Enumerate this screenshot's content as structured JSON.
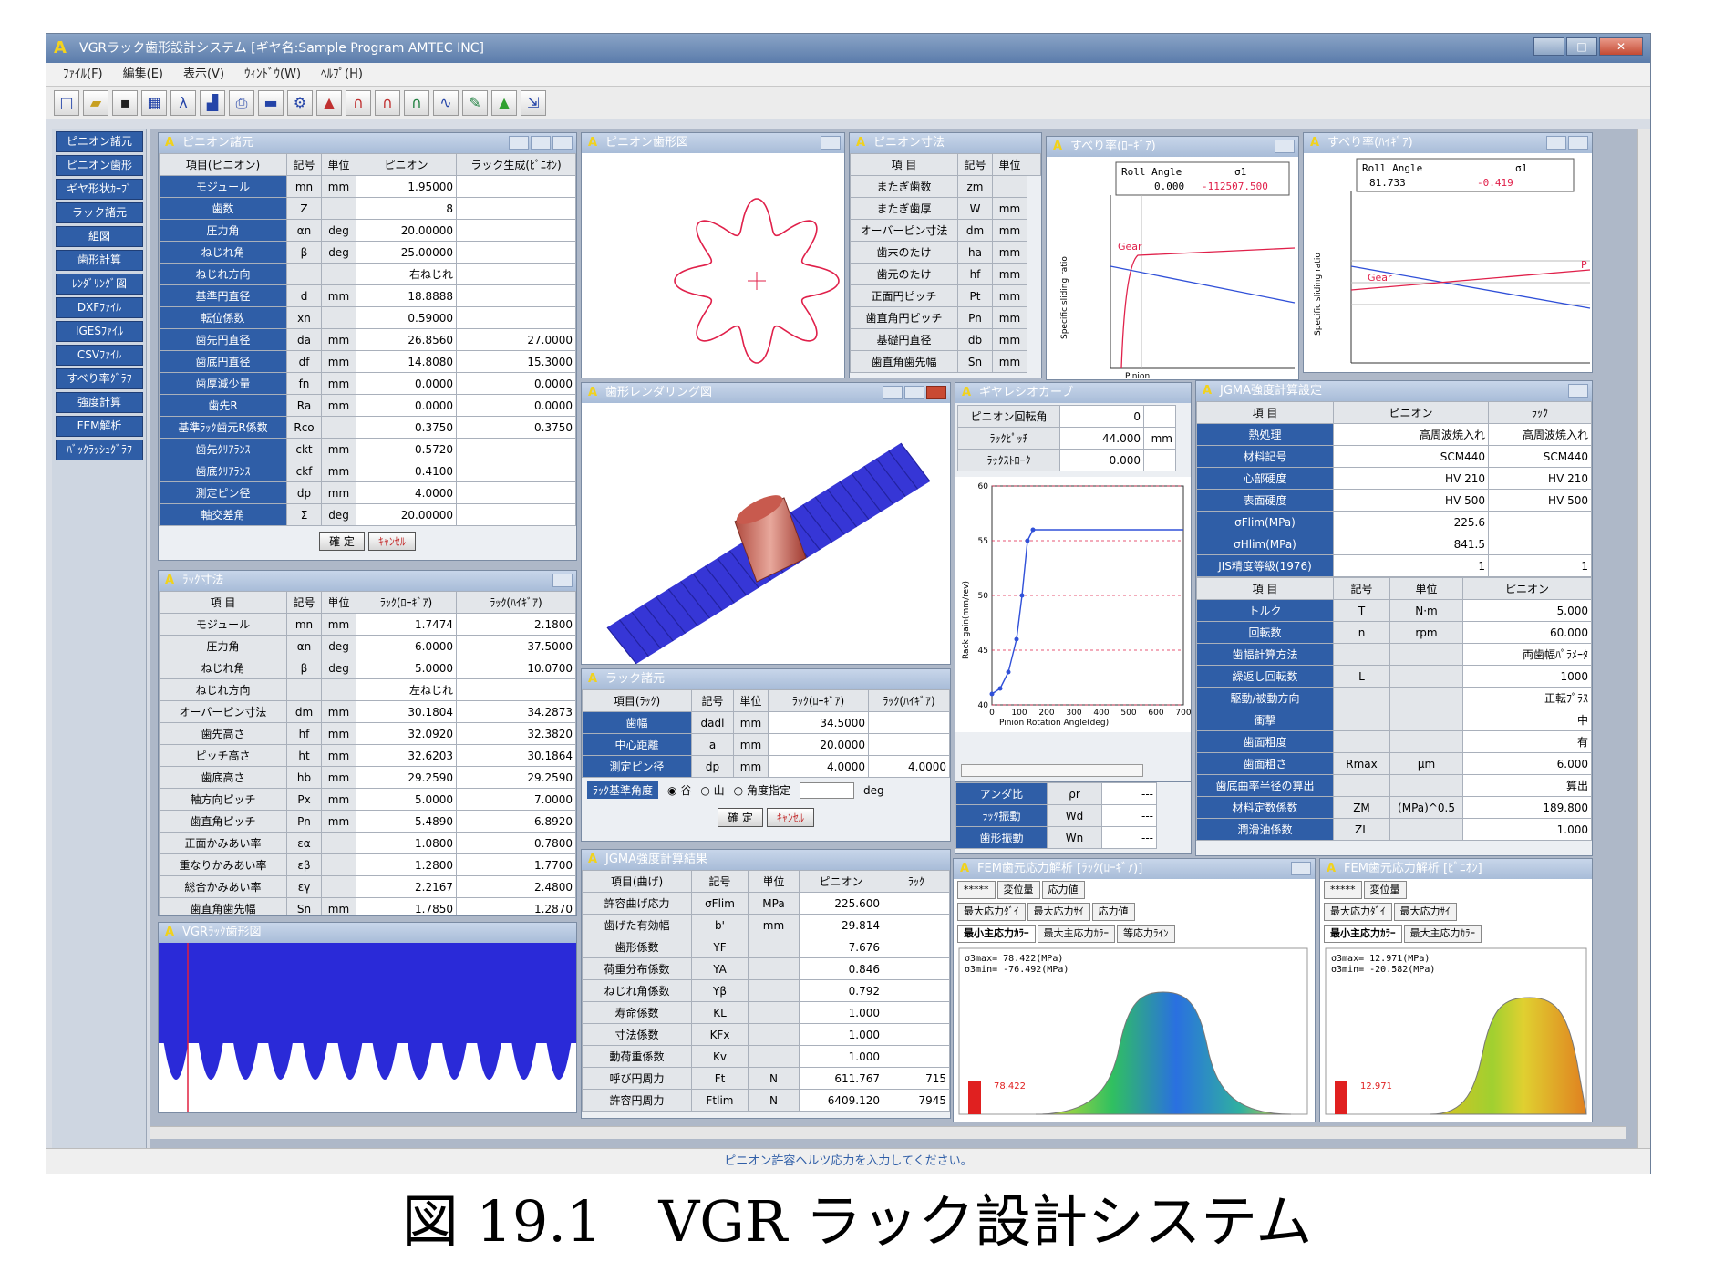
{
  "app": {
    "title": "VGRラック歯形設計システム [ギヤ名:Sample Program AMTEC INC]",
    "status": "ピニオン許容ヘルツ応力を入力してください。"
  },
  "menu": [
    "ﾌｧｲﾙ(F)",
    "編集(E)",
    "表示(V)",
    "ｳｨﾝﾄﾞｳ(W)",
    "ﾍﾙﾌﾟ(H)"
  ],
  "toolbar_icons": [
    "new-file-icon",
    "open-folder-icon",
    "save-icon",
    "table-icon",
    "lambda-icon",
    "chart-icon",
    "print-icon",
    "line-icon",
    "gear-icon",
    "graph-icon",
    "bell-icon",
    "bell-icon",
    "bell-icon",
    "curve-icon",
    "pencil-icon",
    "marker-icon",
    "export-icon"
  ],
  "nav": [
    "ピニオン諸元",
    "ピニオン歯形",
    "ギヤ形状ｶｰﾌﾞ",
    "ラック諸元",
    "組図",
    "歯形計算",
    "ﾚﾝﾀﾞﾘﾝｸﾞ図",
    "DXFﾌｧｲﾙ",
    "IGESﾌｧｲﾙ",
    "CSVﾌｧｲﾙ",
    "すべり率ｸﾞﾗﾌ",
    "強度計算",
    "FEM解析",
    "ﾊﾞｯｸﾗｯｼｭｸﾞﾗﾌ"
  ],
  "pinion": {
    "title": "ピニオン諸元",
    "headers": [
      "項目(ピニオン)",
      "記号",
      "単位",
      "ピニオン",
      "ラック生成(ﾋﾟﾆｵﾝ)"
    ],
    "rows": [
      [
        "モジュール",
        "mn",
        "mm",
        "1.95000",
        ""
      ],
      [
        "歯数",
        "Z",
        "",
        "8",
        ""
      ],
      [
        "圧力角",
        "αn",
        "deg",
        "20.00000",
        ""
      ],
      [
        "ねじれ角",
        "β",
        "deg",
        "25.00000",
        ""
      ],
      [
        "ねじれ方向",
        "",
        "",
        "右ねじれ",
        ""
      ],
      [
        "基準円直径",
        "d",
        "mm",
        "18.8888",
        ""
      ],
      [
        "転位係数",
        "xn",
        "",
        "0.59000",
        ""
      ],
      [
        "歯先円直径",
        "da",
        "mm",
        "26.8560",
        "27.0000"
      ],
      [
        "歯底円直径",
        "df",
        "mm",
        "14.8080",
        "15.3000"
      ],
      [
        "歯厚減少量",
        "fn",
        "mm",
        "0.0000",
        "0.0000"
      ],
      [
        "歯先R",
        "Ra",
        "mm",
        "0.0000",
        "0.0000"
      ],
      [
        "基準ﾗｯｸ歯元R係数",
        "Rco",
        "",
        "0.3750",
        "0.3750"
      ],
      [
        "歯先ｸﾘｱﾗﾝｽ",
        "ckt",
        "mm",
        "0.5720",
        ""
      ],
      [
        "歯底ｸﾘｱﾗﾝｽ",
        "ckf",
        "mm",
        "0.4100",
        ""
      ],
      [
        "測定ピン径",
        "dp",
        "mm",
        "4.0000",
        ""
      ],
      [
        "軸交差角",
        "Σ",
        "deg",
        "20.00000",
        ""
      ]
    ],
    "ok": "確 定",
    "cancel": "ｷｬﾝｾﾙ"
  },
  "rack": {
    "title": "ﾗｯｸ寸法",
    "headers": [
      "項 目",
      "記号",
      "単位",
      "ﾗｯｸ(ﾛｰｷﾞｱ)",
      "ﾗｯｸ(ﾊｲｷﾞｱ)"
    ],
    "rows": [
      [
        "モジュール",
        "mn",
        "mm",
        "1.7474",
        "2.1800"
      ],
      [
        "圧力角",
        "αn",
        "deg",
        "6.0000",
        "37.5000"
      ],
      [
        "ねじれ角",
        "β",
        "deg",
        "5.0000",
        "10.0700"
      ],
      [
        "ねじれ方向",
        "",
        "",
        "左ねじれ",
        ""
      ],
      [
        "オーバーピン寸法",
        "dm",
        "mm",
        "30.1804",
        "34.2873"
      ],
      [
        "歯先高さ",
        "hf",
        "mm",
        "32.0920",
        "32.3820"
      ],
      [
        "ピッチ高さ",
        "ht",
        "mm",
        "32.6203",
        "30.1864"
      ],
      [
        "歯底高さ",
        "hb",
        "mm",
        "29.2590",
        "29.2590"
      ],
      [
        "軸方向ピッチ",
        "Px",
        "mm",
        "5.0000",
        "7.0000"
      ],
      [
        "歯直角ピッチ",
        "Pn",
        "mm",
        "5.4890",
        "6.8920"
      ],
      [
        "正面かみあい率",
        "εα",
        "",
        "1.0800",
        "0.7800"
      ],
      [
        "重なりかみあい率",
        "εβ",
        "",
        "1.2800",
        "1.7700"
      ],
      [
        "総合かみあい率",
        "εγ",
        "",
        "2.2167",
        "2.4800"
      ],
      [
        "歯直角歯先幅",
        "Sn",
        "mm",
        "1.7850",
        "1.2870"
      ]
    ]
  },
  "vgr": {
    "title": "VGRﾗｯｸ歯形図"
  },
  "pinion_profile": {
    "title": "ピニオン歯形図"
  },
  "gear_dims": {
    "title": "ピニオン寸法",
    "headers": [
      "項 目",
      "記号",
      "単位"
    ],
    "rows": [
      [
        "またぎ歯数",
        "zm",
        ""
      ],
      [
        "またぎ歯厚",
        "W",
        "mm"
      ],
      [
        "オーバーピン寸法",
        "dm",
        "mm"
      ],
      [
        "歯末のたけ",
        "ha",
        "mm"
      ],
      [
        "歯元のたけ",
        "hf",
        "mm"
      ],
      [
        "正面円ピッチ",
        "Pt",
        "mm"
      ],
      [
        "歯直角円ピッチ",
        "Pn",
        "mm"
      ],
      [
        "基礎円直径",
        "db",
        "mm"
      ],
      [
        "歯直角歯先幅",
        "Sn",
        "mm"
      ]
    ]
  },
  "slip1": {
    "title": "すべり率(ﾛｰｷﾞｱ)",
    "col1": "Roll Angle",
    "col2": "σ1",
    "val1": "0.000",
    "val2": "-112507.500",
    "series": "Gear",
    "ylabel": "Specific sliding ratio",
    "xlabel": "Pinion"
  },
  "slip2": {
    "title": "すべり率(ﾊｲｷﾞｱ)",
    "col1": "Roll Angle",
    "col2": "σ1",
    "val1": "81.733",
    "val2": "-0.419",
    "series": "Gear",
    "series2": "P",
    "ylabel": "Specific sliding ratio"
  },
  "rendering": {
    "title": "歯形レンダリング図"
  },
  "gear_curve": {
    "title": "ギヤレシオカーブ",
    "rows": [
      [
        "ピニオン回転角",
        "0",
        ""
      ],
      [
        "ﾗｯｸﾋﾟｯﾁ",
        "44.000",
        "mm"
      ],
      [
        "ﾗｯｸｽﾄﾛｰｸ",
        "0.000",
        ""
      ]
    ],
    "ylabel": "Rack gain(mm/rev)",
    "xlabel": "Pinion Rotation Angle(deg)",
    "xticks": [
      "0",
      "100",
      "200",
      "300",
      "400",
      "500",
      "600",
      "700"
    ],
    "yticks": [
      "60",
      "55",
      "50",
      "45",
      "40"
    ],
    "extra_rows": [
      [
        "アンダ比",
        "ρr",
        "---"
      ],
      [
        "ﾗｯｸ振動",
        "Wd",
        "---"
      ],
      [
        "歯形振動",
        "Wn",
        "---"
      ]
    ]
  },
  "strength": {
    "title": "JGMA強度計算設定",
    "headers": [
      "項 目",
      "ピニオン",
      "ﾗｯｸ"
    ],
    "rows": [
      [
        "熱処理",
        "高周波焼入れ",
        "高周波焼入れ"
      ],
      [
        "材料記号",
        "SCM440",
        "SCM440"
      ],
      [
        "心部硬度",
        "HV 210",
        "HV 210"
      ],
      [
        "表面硬度",
        "HV 500",
        "HV 500"
      ],
      [
        "σFlim(MPa)",
        "225.6",
        ""
      ],
      [
        "σHlim(MPa)",
        "841.5",
        ""
      ],
      [
        "JIS精度等級(1976)",
        "1",
        "1"
      ]
    ],
    "headers2": [
      "項 目",
      "記号",
      "単位",
      "ピニオン"
    ],
    "rows2": [
      [
        "トルク",
        "T",
        "N·m",
        "5.000"
      ],
      [
        "回転数",
        "n",
        "rpm",
        "60.000"
      ],
      [
        "歯幅計算方法",
        "",
        "",
        "両歯幅ﾊﾟﾗﾒｰﾀ"
      ],
      [
        "繰返し回転数",
        "L",
        "",
        "1000"
      ],
      [
        "駆動/被動方向",
        "",
        "",
        "正転ﾌﾟﾗｽ"
      ],
      [
        "衝撃",
        "",
        "",
        "中"
      ],
      [
        "歯面粗度",
        "",
        "",
        "有"
      ],
      [
        "歯面粗さ",
        "Rmax",
        "μm",
        "6.000"
      ],
      [
        "歯底曲率半径の算出",
        "",
        "",
        "算出"
      ],
      [
        "材料定数係数",
        "ZM",
        "(MPa)^0.5",
        "189.800"
      ],
      [
        "潤滑油係数",
        "ZL",
        "",
        "1.000"
      ]
    ]
  },
  "contact": {
    "title": "ラック諸元",
    "headers": [
      "項目(ﾗｯｸ)",
      "記号",
      "単位",
      "ﾗｯｸ(ﾛｰｷﾞｱ)",
      "ﾗｯｸ(ﾊｲｷﾞｱ)"
    ],
    "rows": [
      [
        "歯幅",
        "dadl",
        "mm",
        "34.5000",
        ""
      ],
      [
        "中心距離",
        "a",
        "mm",
        "20.0000",
        ""
      ],
      [
        "測定ピン径",
        "dp",
        "mm",
        "4.0000",
        "4.0000"
      ]
    ],
    "orient_label": "ﾗｯｸ基準角度",
    "radio": [
      "谷",
      "山",
      "角度指定"
    ],
    "unit": "deg",
    "ok": "確 定",
    "cancel": "ｷｬﾝｾﾙ"
  },
  "jgma": {
    "title": "JGMA強度計算結果",
    "headers": [
      "項目(曲げ)",
      "記号",
      "単位",
      "ピニオン",
      "ﾗｯｸ"
    ],
    "rows": [
      [
        "許容曲げ応力",
        "σFlim",
        "MPa",
        "225.600",
        ""
      ],
      [
        "歯げた有効幅",
        "b'",
        "mm",
        "29.814",
        ""
      ],
      [
        "歯形係数",
        "YF",
        "",
        "7.676",
        ""
      ],
      [
        "荷重分布係数",
        "YA",
        "",
        "0.846",
        ""
      ],
      [
        "ねじれ角係数",
        "Yβ",
        "",
        "0.792",
        ""
      ],
      [
        "寿命係数",
        "KL",
        "",
        "1.000",
        ""
      ],
      [
        "寸法係数",
        "KFx",
        "",
        "1.000",
        ""
      ],
      [
        "動荷重係数",
        "Kv",
        "",
        "1.000",
        ""
      ],
      [
        "呼び円周力",
        "Ft",
        "N",
        "611.767",
        "715"
      ],
      [
        "許容円周力",
        "Ftlim",
        "N",
        "6409.120",
        "7945"
      ]
    ]
  },
  "fem1": {
    "title": "FEM歯元応力解析 [ﾗｯｸ(ﾛｰｷﾞｱ)]",
    "tabs1": [
      "*****",
      "変位量",
      "応力値"
    ],
    "tabs2": [
      "最大応力ﾀﾞｲ",
      "最大応力ｻｲ",
      "応力値"
    ],
    "tabs3": [
      "最小主応力ｶﾗｰ",
      "最大主応力ｶﾗｰ",
      "等応力ﾗｲﾝ"
    ],
    "max": "σ3max= 78.422(MPa)",
    "min": "σ3min= -76.492(MPa)",
    "marker": "78.422"
  },
  "fem2": {
    "title": "FEM歯元応力解析 [ﾋﾟﾆｵﾝ]",
    "tabs1": [
      "*****",
      "変位量"
    ],
    "tabs2": [
      "最大応力ﾀﾞｲ",
      "最大応力ｻｲ"
    ],
    "tabs3": [
      "最小主応力ｶﾗｰ",
      "最大主応力ｶﾗｰ"
    ],
    "max": "σ3max= 12.971(MPa)",
    "min": "σ3min= -20.582(MPa)",
    "marker": "12.971"
  },
  "caption": "図 19.1　VGR ラック設計システム",
  "colors": {
    "accent": "#2f5ea7",
    "rack": "#2a2ad8",
    "pinion_curve": "#e0204a",
    "gear_line": "#3050d8"
  }
}
